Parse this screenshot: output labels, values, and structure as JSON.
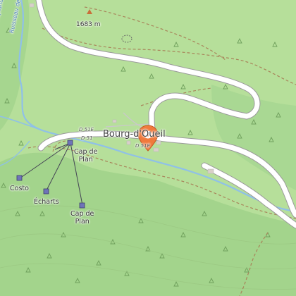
{
  "map": {
    "labels": {
      "town": "Bourg-d'Oueil",
      "elevation": "1683 m",
      "stream": "Ruisseau de Coplantigue",
      "stream2": "Ruisseau de Coplantique",
      "road1": "D 51E",
      "road2": "D 51",
      "road3": "D 51E",
      "costo": "Costo",
      "echarts": "Écharts",
      "cap_de_plan_1_line1": "Cap de",
      "cap_de_plan_1_line2": "Plan",
      "cap_de_plan_2_line1": "Cap de",
      "cap_de_plan_2_line2": "Plan"
    },
    "colors": {
      "meadow": "#b6df9a",
      "forest": "#9fd08a",
      "road": "#ffffff",
      "water": "#8fc0e8",
      "track": "#a8845a",
      "marker": "#f07a3c"
    }
  }
}
